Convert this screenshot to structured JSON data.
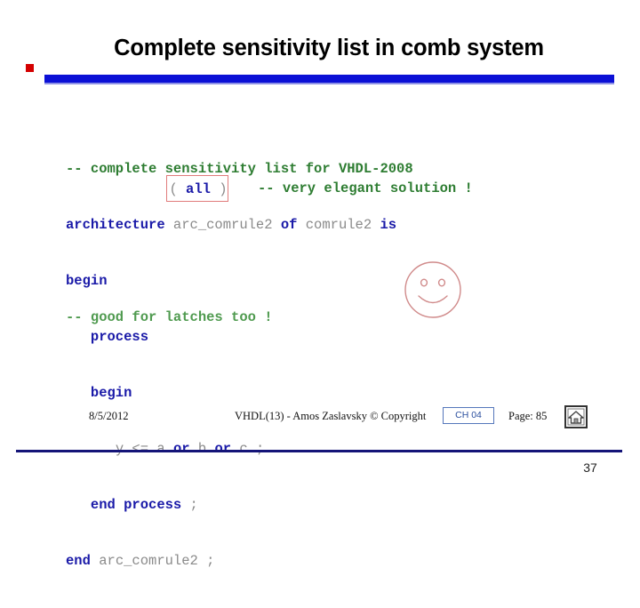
{
  "slide": {
    "title": "Complete sensitivity list in comb system",
    "bullet_color": "#d40000",
    "rule_color": "#0b10d6",
    "number": "37"
  },
  "code": {
    "lines": [
      [
        {
          "text": "-- complete sensitivity list for VHDL-2008",
          "style": "cmt"
        }
      ],
      [
        {
          "text": "architecture ",
          "style": "kw"
        },
        {
          "text": "arc_comrule2 ",
          "style": "id"
        },
        {
          "text": "of ",
          "style": "kw"
        },
        {
          "text": "comrule2 ",
          "style": "id"
        },
        {
          "text": "is",
          "style": "kw"
        }
      ],
      [
        {
          "text": "begin",
          "style": "kw"
        }
      ],
      [
        {
          "text": "   process",
          "style": "kw"
        }
      ],
      [
        {
          "text": "   begin",
          "style": "kw"
        }
      ],
      [
        {
          "text": "      ",
          "style": "id"
        },
        {
          "text": "y ",
          "style": "id"
        },
        {
          "text": "<= ",
          "style": "op"
        },
        {
          "text": "a ",
          "style": "id"
        },
        {
          "text": "or ",
          "style": "kw"
        },
        {
          "text": "b ",
          "style": "id"
        },
        {
          "text": "or ",
          "style": "kw"
        },
        {
          "text": "c ",
          "style": "id"
        },
        {
          "text": ";",
          "style": "op"
        }
      ],
      [
        {
          "text": "   end process ",
          "style": "kw"
        },
        {
          "text": ";",
          "style": "op"
        }
      ],
      [
        {
          "text": "end ",
          "style": "kw"
        },
        {
          "text": "arc_comrule2 ;",
          "style": "id"
        }
      ]
    ],
    "callout": {
      "open_paren": "( ",
      "keyword": "all",
      "close_paren": " )",
      "border_color": "#e07b7b"
    },
    "elegant_comment": "-- very elegant solution !",
    "latch_comment": "-- good for latches too !"
  },
  "smiley": {
    "stroke_color": "#d08a8a"
  },
  "footer": {
    "date": "8/5/2012",
    "credit": "VHDL(13) - Amos Zaslavsky © Copyright",
    "chapter": "CH 04",
    "page": "Page: 85",
    "home_icon": "home-icon"
  }
}
